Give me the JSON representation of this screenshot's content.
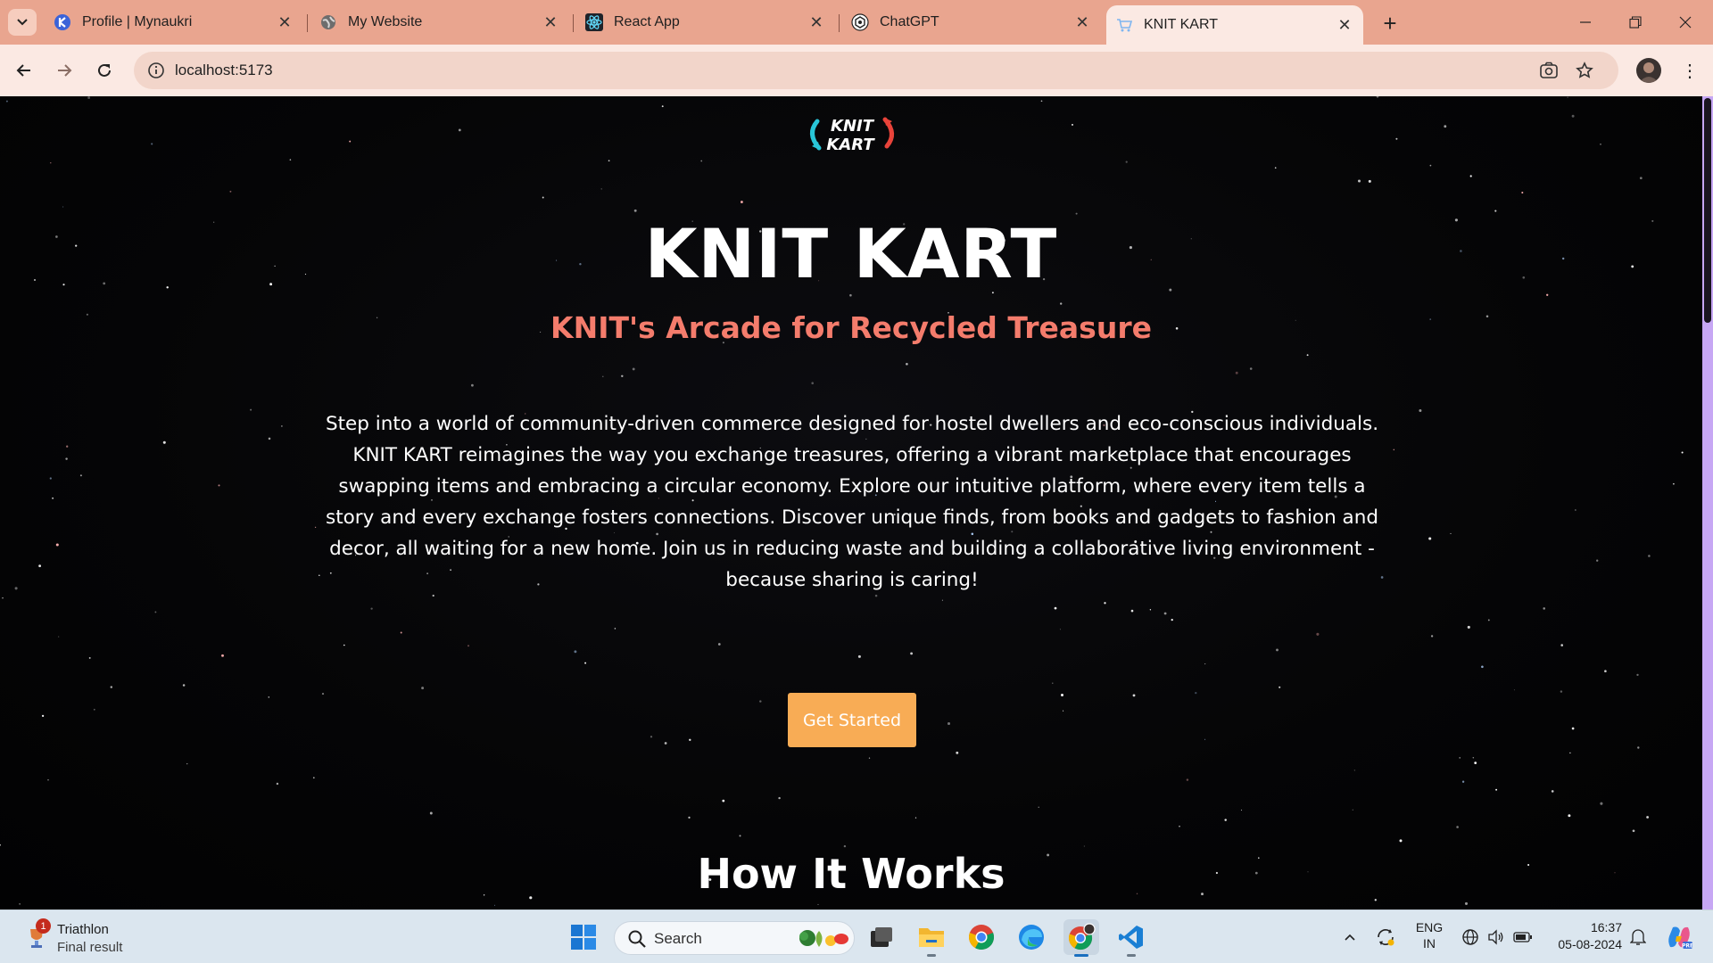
{
  "browser": {
    "tabs": [
      {
        "title": "Profile | Mynaukri",
        "icon": "mynaukri-favicon"
      },
      {
        "title": "My Website",
        "icon": "globe-icon"
      },
      {
        "title": "React App",
        "icon": "react-icon"
      },
      {
        "title": "ChatGPT",
        "icon": "chatgpt-icon"
      },
      {
        "title": "KNIT KART",
        "icon": "cart-favicon",
        "active": true
      }
    ],
    "url": "localhost:5173"
  },
  "page": {
    "logo_text": [
      "KNIT",
      "KART"
    ],
    "title": "KNIT KART",
    "subtitle": "KNIT's Arcade for Recycled Treasure",
    "description": "Step into a world of community-driven commerce designed for hostel dwellers and eco-conscious individuals. KNIT KART reimagines the way you exchange treasures, offering a vibrant marketplace that encourages swapping items and embracing a circular economy. Explore our intuitive platform, where every item tells a story and every exchange fosters connections. Discover unique finds, from books and gadgets to fashion and decor, all waiting for a new home. Join us in reducing waste and building a collaborative living environment - because sharing is caring!",
    "cta_label": "Get Started",
    "section_heading": "How It Works",
    "colors": {
      "subtitle": "#f47c6c",
      "cta": "#f8ac55",
      "background": "#050506"
    }
  },
  "taskbar": {
    "weather": {
      "badge": "1",
      "title": "Triathlon",
      "subtitle": "Final result"
    },
    "search_placeholder": "Search",
    "language": [
      "ENG",
      "IN"
    ],
    "time": "16:37",
    "date": "05-08-2024"
  }
}
